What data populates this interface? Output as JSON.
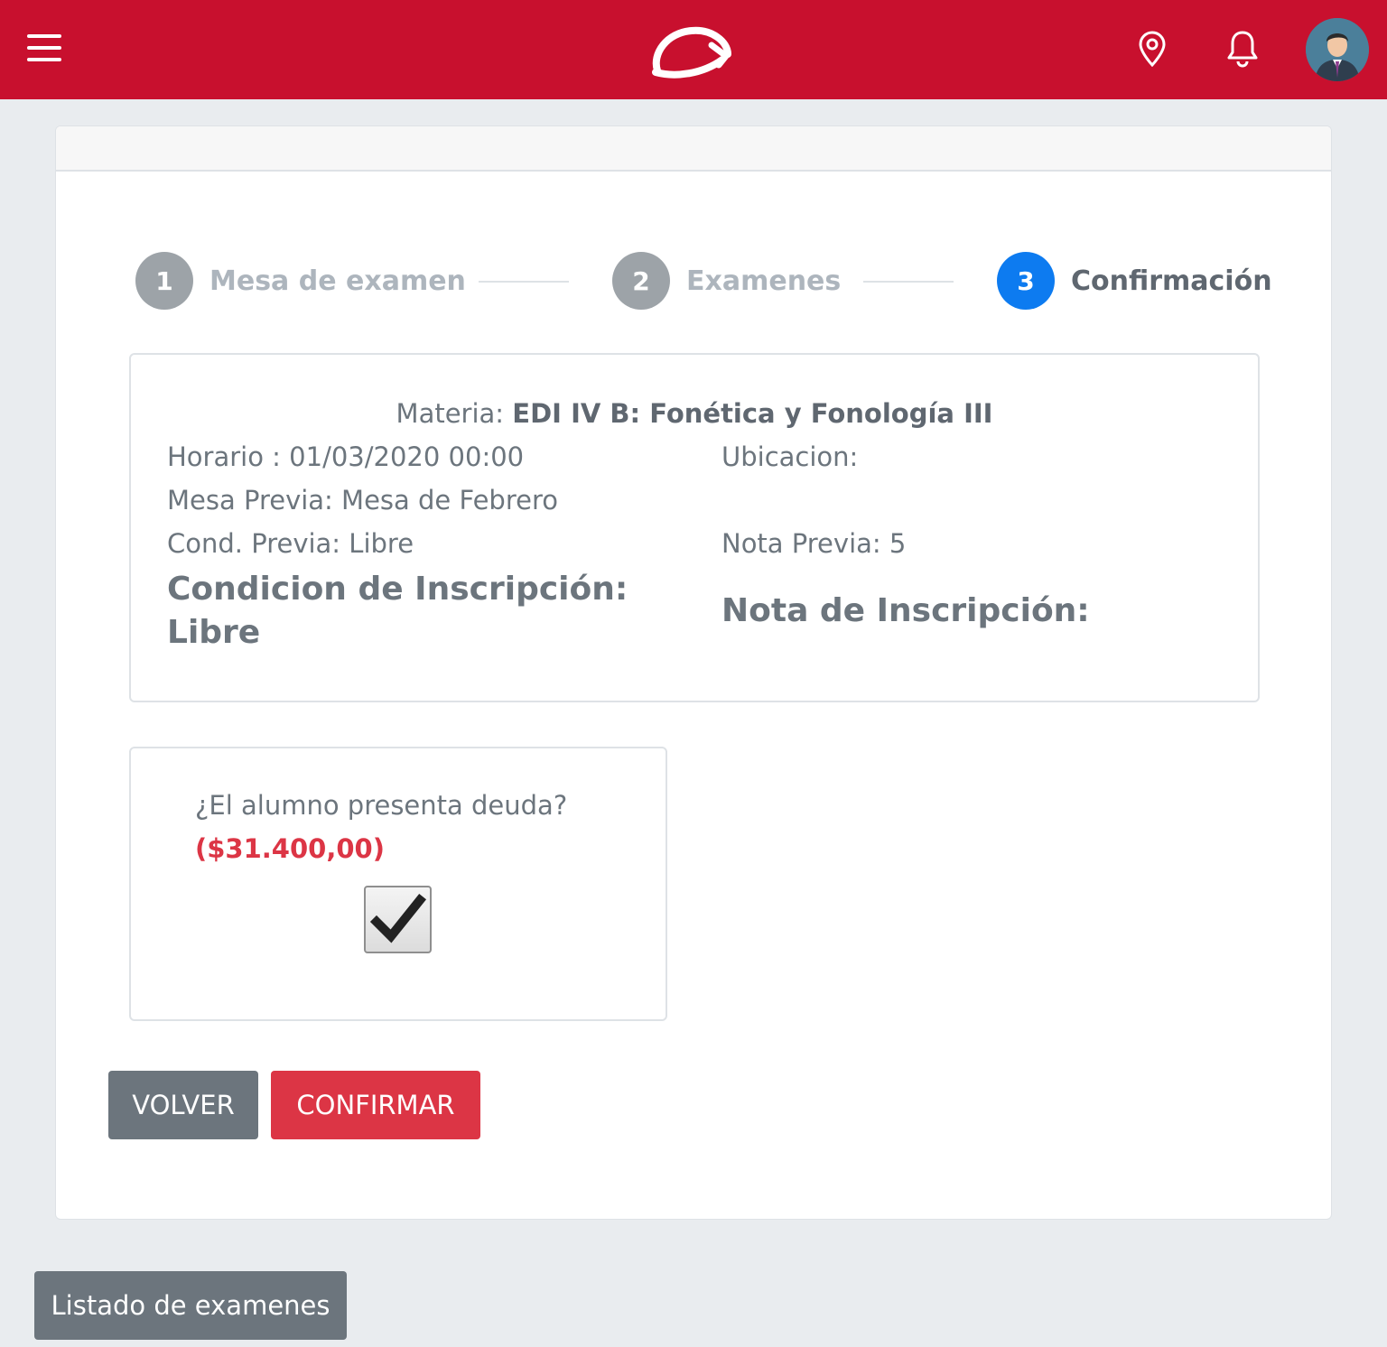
{
  "navbar": {
    "background": "#c8102e",
    "menu_icon": "hamburger-menu-icon",
    "logo_icon": "brand-logo",
    "location_icon": "map-pin-icon",
    "notification_icon": "bell-icon",
    "avatar_icon": "user-avatar"
  },
  "stepper": {
    "steps": [
      {
        "number": "1",
        "label": "Mesa de examen",
        "active": false
      },
      {
        "number": "2",
        "label": "Examenes",
        "active": false
      },
      {
        "number": "3",
        "label": "Confirmación",
        "active": true
      }
    ],
    "active_color": "#0d7bf0",
    "inactive_color": "#9da3a8"
  },
  "details": {
    "materia_label": "Materia: ",
    "materia_value": "EDI IV B: Fonética y Fonología III",
    "horario": "Horario : 01/03/2020 00:00",
    "ubicacion": "Ubicacion:",
    "mesa_previa": "Mesa Previa: Mesa de Febrero",
    "cond_previa": "Cond. Previa: Libre",
    "nota_previa": "Nota Previa: 5",
    "condicion_inscripcion": "Condicion de Inscripción: Libre",
    "nota_inscripcion": "Nota de Inscripción:"
  },
  "debt": {
    "question": "¿El alumno presenta deuda?",
    "amount": "($31.400,00)",
    "checked": true,
    "amount_color": "#dc3545"
  },
  "actions": {
    "back_label": "VOLVER",
    "confirm_label": "CONFIRMAR",
    "list_label": "Listado de examenes"
  }
}
